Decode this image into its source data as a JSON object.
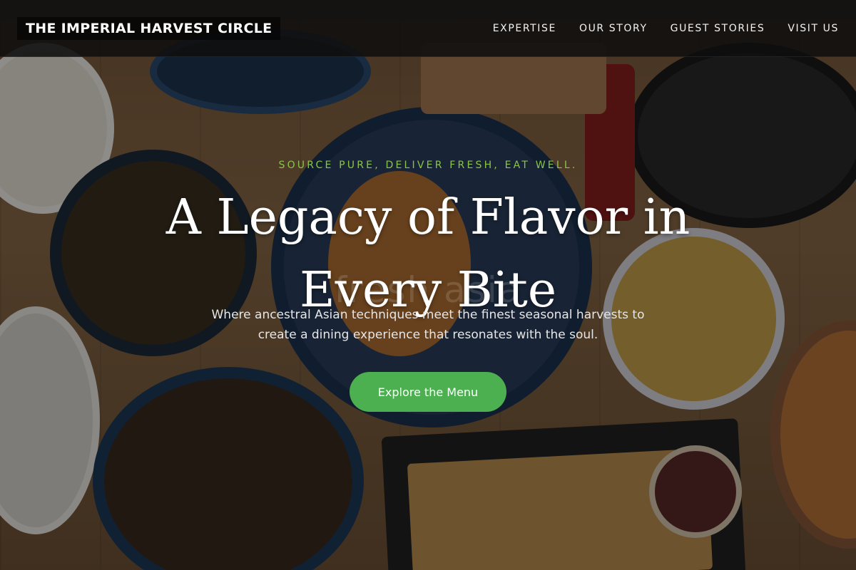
{
  "brand": {
    "name": "THE IMPERIAL HARVEST CIRCLE"
  },
  "nav": {
    "items": [
      {
        "label": "EXPERTISE"
      },
      {
        "label": "OUR STORY"
      },
      {
        "label": "GUEST STORIES"
      },
      {
        "label": "VISIT US"
      }
    ]
  },
  "hero": {
    "tagline": "SOURCE PURE, DELIVER FRESH, EAT WELL.",
    "headline": "A Legacy of Flavor in Every Bite",
    "watermark": "fresh asia",
    "subtitle": "Where ancestral Asian techniques meet the finest seasonal harvests to create a dining experience that resonates with the soul.",
    "cta_label": "Explore the Menu",
    "background": "food-table-photo"
  },
  "colors": {
    "accent_green": "#4caf50",
    "tagline_green": "#8bc34a",
    "navbar_bg": "#0f0f0f"
  }
}
